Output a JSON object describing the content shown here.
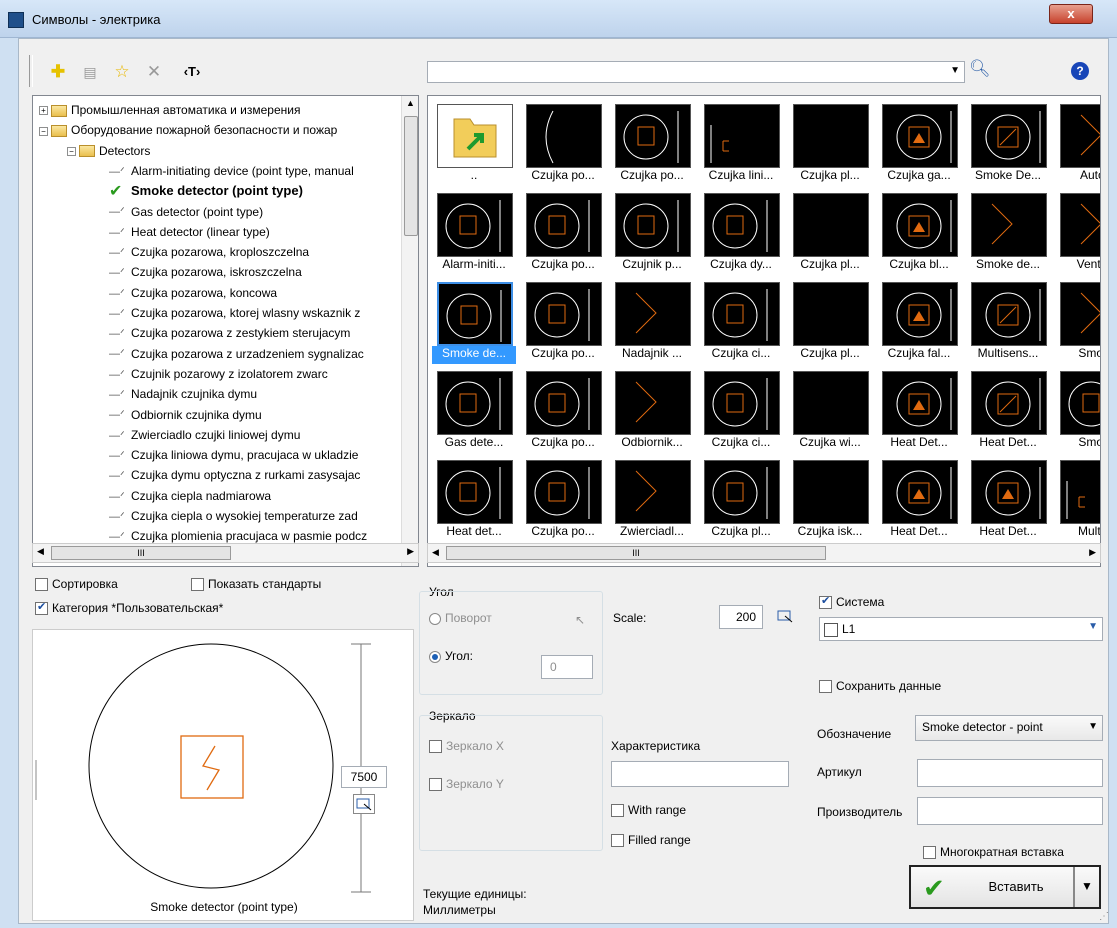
{
  "window": {
    "title": "Символы - электрика",
    "close_label": "x"
  },
  "toolbar": {
    "text_tool_label": "‹T›",
    "search_value": ""
  },
  "tree": {
    "items": [
      {
        "label": "Промышленная автоматика и измерения",
        "kind": "folder",
        "level": 0,
        "expander": "+"
      },
      {
        "label": "Оборудование пожарной безопасности и пожар",
        "kind": "folder",
        "level": 0,
        "expander": "−"
      },
      {
        "label": "Detectors",
        "kind": "folder",
        "level": 1,
        "expander": "−"
      },
      {
        "label": "Alarm-initiating device (point type, manual",
        "kind": "leaf"
      },
      {
        "label": "Smoke detector (point type)",
        "kind": "leaf",
        "selected": true
      },
      {
        "label": "Gas detector (point type)",
        "kind": "leaf"
      },
      {
        "label": "Heat detector (linear type)",
        "kind": "leaf"
      },
      {
        "label": "Czujka pozarowa, kroploszczelna",
        "kind": "leaf"
      },
      {
        "label": "Czujka pozarowa, iskroszczelna",
        "kind": "leaf"
      },
      {
        "label": "Czujka pozarowa, koncowa",
        "kind": "leaf"
      },
      {
        "label": "Czujka pozarowa, ktorej wlasny wskaznik z",
        "kind": "leaf"
      },
      {
        "label": "Czujka pozarowa z zestykiem sterujacym",
        "kind": "leaf"
      },
      {
        "label": "Czujka pozarowa z urzadzeniem sygnalizac",
        "kind": "leaf"
      },
      {
        "label": "Czujnik pozarowy z izolatorem zwarc",
        "kind": "leaf"
      },
      {
        "label": "Nadajnik czujnika dymu",
        "kind": "leaf"
      },
      {
        "label": "Odbiornik czujnika dymu",
        "kind": "leaf"
      },
      {
        "label": "Zwierciadlo czujki liniowej dymu",
        "kind": "leaf"
      },
      {
        "label": "Czujka liniowa dymu, pracujaca w ukladzie",
        "kind": "leaf"
      },
      {
        "label": "Czujka dymu optyczna z rurkami zasysajac",
        "kind": "leaf"
      },
      {
        "label": "Czujka ciepla nadmiarowa",
        "kind": "leaf"
      },
      {
        "label": "Czujka ciepla o wysokiej temperaturze zad",
        "kind": "leaf"
      },
      {
        "label": "Czujka plomienia pracujaca w pasmie podcz",
        "kind": "leaf"
      }
    ]
  },
  "grid": {
    "rows": [
      [
        "..",
        "Czujka po...",
        "Czujka po...",
        "Czujka lini...",
        "Czujka pl...",
        "Czujka ga...",
        "Smoke De...",
        "Auto fi"
      ],
      [
        "Alarm-initi...",
        "Czujka po...",
        "Czujnik p...",
        "Czujka dy...",
        "Czujka pl...",
        "Czujka bl...",
        "Smoke de...",
        "Vent du"
      ],
      [
        "Smoke de...",
        "Czujka po...",
        "Nadajnik ...",
        "Czujka ci...",
        "Czujka pl...",
        "Czujka fal...",
        "Multisens...",
        "Smoke"
      ],
      [
        "Gas dete...",
        "Czujka po...",
        "Odbiornik...",
        "Czujka ci...",
        "Czujka wi...",
        "Heat Det...",
        "Heat Det...",
        "Smoke"
      ],
      [
        "Heat det...",
        "Czujka po...",
        "Zwierciadl...",
        "Czujka pl...",
        "Czujka isk...",
        "Heat Det...",
        "Heat Det...",
        "Multise"
      ]
    ],
    "scroll_glyph": "III"
  },
  "options": {
    "sort_label": "Сортировка",
    "show_standards_label": "Показать стандарты",
    "category_label": "Категория *Пользовательская*",
    "angle_group": "Угол",
    "rotation_label": "Поворот",
    "angle_label": "Угол:",
    "angle_value": "0",
    "mirror_group": "Зеркало",
    "mirror_x_label": "Зеркало X",
    "mirror_y_label": "Зеркало Y",
    "scale_label": "Scale:",
    "scale_value": "200",
    "characteristic_label": "Характеристика",
    "characteristic_value": "",
    "with_range_label": "With range",
    "filled_range_label": "Filled range",
    "units_label": "Текущие единицы:",
    "units_value": "Миллиметры",
    "system_label": "Система",
    "system_value": "L1",
    "save_data_label": "Сохранить данные",
    "designation_label": "Обозначение",
    "designation_value": "Smoke detector - point",
    "article_label": "Артикул",
    "article_value": "",
    "manufacturer_label": "Производитель",
    "manufacturer_value": "",
    "multi_insert_label": "Многократная вставка",
    "insert_label": "Вставить"
  },
  "preview": {
    "size_value": "7500",
    "caption": "Smoke detector (point type)"
  },
  "colors": {
    "symbol": "#e06a10",
    "selection": "#3399ff",
    "accent_green": "#2a9a1e"
  }
}
